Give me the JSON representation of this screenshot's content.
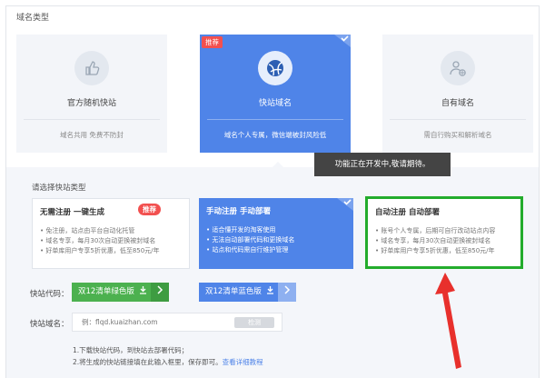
{
  "section_title": "域名类型",
  "cards": [
    {
      "title": "官方随机快站",
      "desc": "域名共用 免费不防封"
    },
    {
      "title": "快站域名",
      "desc": "域名个人专属，微信端被封风险低",
      "tag": "推荐"
    },
    {
      "title": "自有域名",
      "desc": "需自行购买和解析域名"
    }
  ],
  "tooltip": "功能正在开发中,敬请期待。",
  "sub_title": "请选择快站类型",
  "options": [
    {
      "title": "无需注册 一键生成",
      "tag": "推荐",
      "items": [
        "免注册，站点由平台自动化托管",
        "域名专享，每月30次自动更换被封域名",
        "好单库用户专享5折优惠，低至850元/年"
      ]
    },
    {
      "title": "手动注册 手动部署",
      "items": [
        "适合懂开发的淘客使用",
        "无法自动部署代码和更换域名",
        "站点和代码需自行维护管理"
      ]
    },
    {
      "title": "自动注册 自动部署",
      "items": [
        "账号个人专属，后期可自行改动站点内容",
        "域名专享，每月30次自动更换被封域名",
        "好单库用户专享5折优惠，低至850元/年"
      ]
    }
  ],
  "code_label": "快站代码：",
  "buttons": {
    "green": "双12清单绿色版",
    "blue": "双12清单蓝色版"
  },
  "domain_label": "快站域名：",
  "domain_input": {
    "placeholder": "例：flqd.kuaizhan.com",
    "detect": "检测"
  },
  "notes": {
    "line1": "1.下载快站代码，到快站去部署代码；",
    "line2": "2.将生成的快站链接填在此输入框里，保存即可。",
    "link": "查看详细教程"
  },
  "colors": {
    "accent_blue": "#4f84e8",
    "green": "#4cb14f",
    "highlight_border": "#23ac2c",
    "arrow_red": "#e8302c"
  }
}
